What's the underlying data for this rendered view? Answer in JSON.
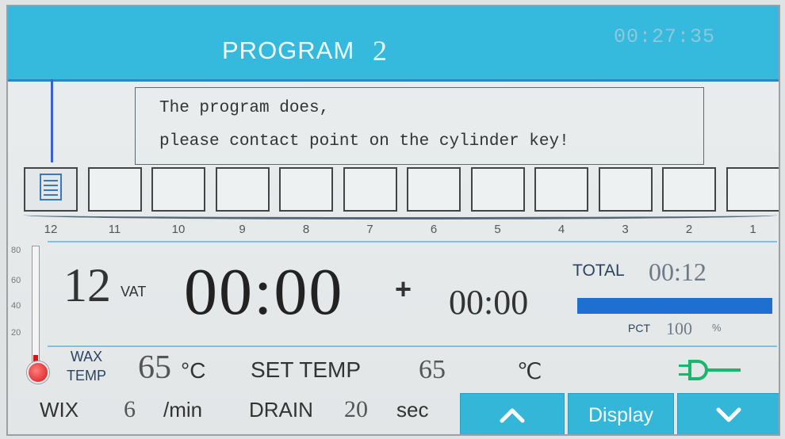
{
  "header": {
    "title": "PROGRAM",
    "program_number": "2",
    "clock": "00:27:35"
  },
  "message": {
    "line1": "The program does,",
    "line2": "please contact point on the cylinder key!"
  },
  "vats": {
    "labels": [
      "12",
      "11",
      "10",
      "9",
      "8",
      "7",
      "6",
      "5",
      "4",
      "3",
      "2",
      "1"
    ],
    "active_vat": "12"
  },
  "thermometer": {
    "ticks": [
      "80",
      "60",
      "40",
      "20"
    ]
  },
  "status": {
    "current_vat": "12",
    "vat_label": "VAT",
    "elapsed_time": "00:00",
    "plus": "+",
    "extra_time": "00:00",
    "total_label": "TOTAL",
    "total_time": "00:12",
    "progress_percent": 100,
    "pct_label": "PCT",
    "pct_value": "100",
    "pct_unit": "%"
  },
  "temperature": {
    "wax_label_line1": "WAX",
    "wax_label_line2": "TEMP",
    "wax_temp": "65",
    "unit": "°C",
    "set_temp_label": "SET TEMP",
    "set_temp": "65",
    "set_temp_unit": "℃"
  },
  "bottom": {
    "mix_label": "WIX",
    "mix_value": "6",
    "mix_unit": "/min",
    "drain_label": "DRAIN",
    "drain_value": "20",
    "drain_unit": "sec",
    "display_label": "Display"
  },
  "colors": {
    "header": "#35b9dc",
    "button": "#34b6d9",
    "progress": "#1f6fd1",
    "plug": "#18b66e"
  }
}
